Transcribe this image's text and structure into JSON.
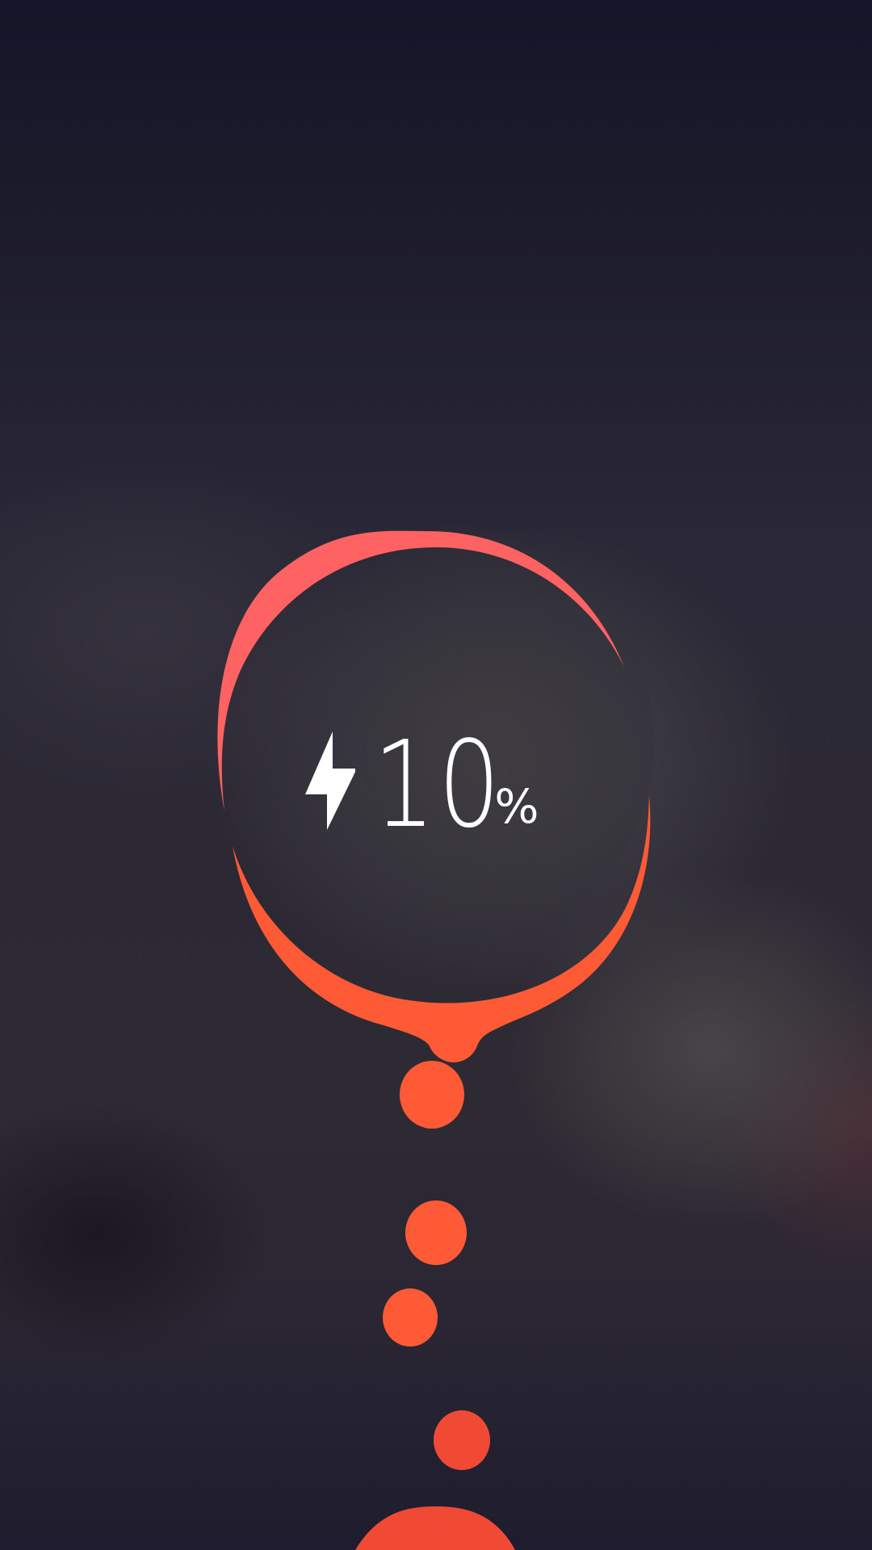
{
  "charging": {
    "level": "10",
    "unit": "%",
    "level_value": 10,
    "state_icon": "lightning-bolt-icon"
  },
  "colors": {
    "ring_top": "#ff6262",
    "ring_bottom": "#ff5a36",
    "droplet": "#ff5a36",
    "droplet_low": "#f04a34",
    "text": "#ffffff"
  }
}
